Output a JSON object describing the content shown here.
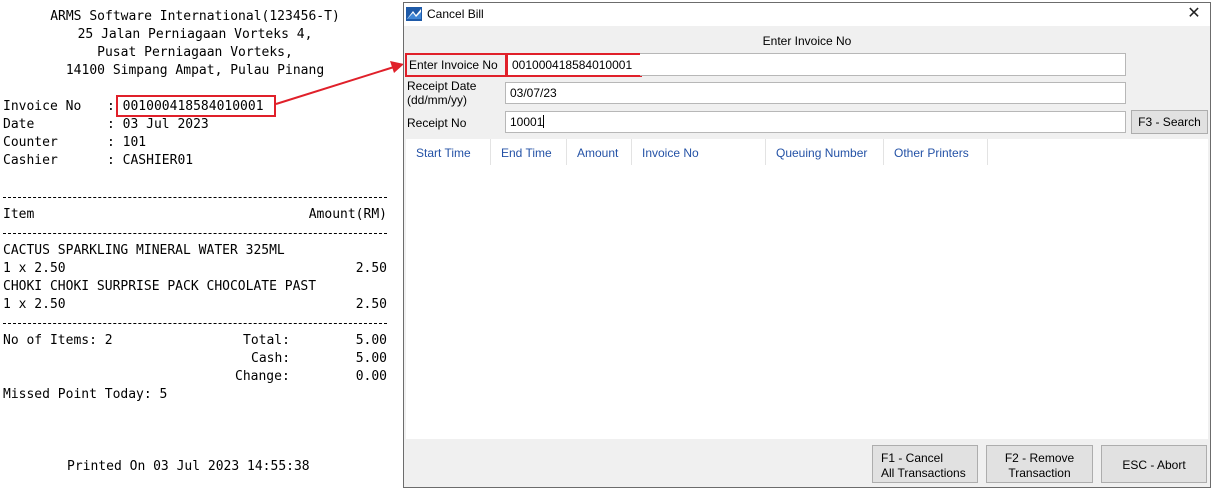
{
  "receipt": {
    "company": "ARMS Software International(123456-T)",
    "address1": "25 Jalan Perniagaan Vorteks 4,",
    "address2": "Pusat Perniagaan Vorteks,",
    "address3": "14100 Simpang Ampat, Pulau Pinang",
    "fields": [
      {
        "label": "Invoice No",
        "value": "001000418584010001"
      },
      {
        "label": "Date",
        "value": "03 Jul 2023"
      },
      {
        "label": "Counter",
        "value": "101"
      },
      {
        "label": "Cashier",
        "value": "CASHIER01"
      }
    ],
    "item_header": "Item",
    "amount_header": "Amount(RM)",
    "items": [
      {
        "name": "CACTUS SPARKLING MINERAL WATER 325ML",
        "qty_price": "1 x 2.50",
        "amount": "2.50"
      },
      {
        "name": "CHOKI CHOKI SURPRISE PACK CHOCOLATE PAST",
        "qty_price": "1 x 2.50",
        "amount": "2.50"
      }
    ],
    "no_of_items": "No of Items: 2",
    "total_label": "Total:",
    "total": "5.00",
    "cash_label": "Cash:",
    "cash": "5.00",
    "change_label": "Change:",
    "change": "0.00",
    "missed_point": "Missed Point Today: 5",
    "printed_on": "Printed On 03 Jul 2023 14:55:38"
  },
  "dialog": {
    "title": "Cancel Bill",
    "close_glyph": "✕",
    "heading": "Enter Invoice No",
    "invoice_label": "Enter Invoice No",
    "invoice_value": "001000418584010001",
    "date_label_1": "Receipt Date",
    "date_label_2": "(dd/mm/yy)",
    "date_value": "03/07/23",
    "receipt_label": "Receipt No",
    "receipt_value": "10001",
    "search_button": "F3 - Search",
    "columns": [
      "Start Time",
      "End Time",
      "Amount",
      "Invoice No",
      "Queuing Number",
      "Other Printers"
    ],
    "buttons": {
      "cancel_all_1": "F1 - Cancel",
      "cancel_all_2": "All Transactions",
      "remove_1": "F2 - Remove",
      "remove_2": "Transaction",
      "abort": "ESC - Abort"
    }
  },
  "colors": {
    "highlight": "#e0202a",
    "column_header_text": "#2452a6"
  }
}
